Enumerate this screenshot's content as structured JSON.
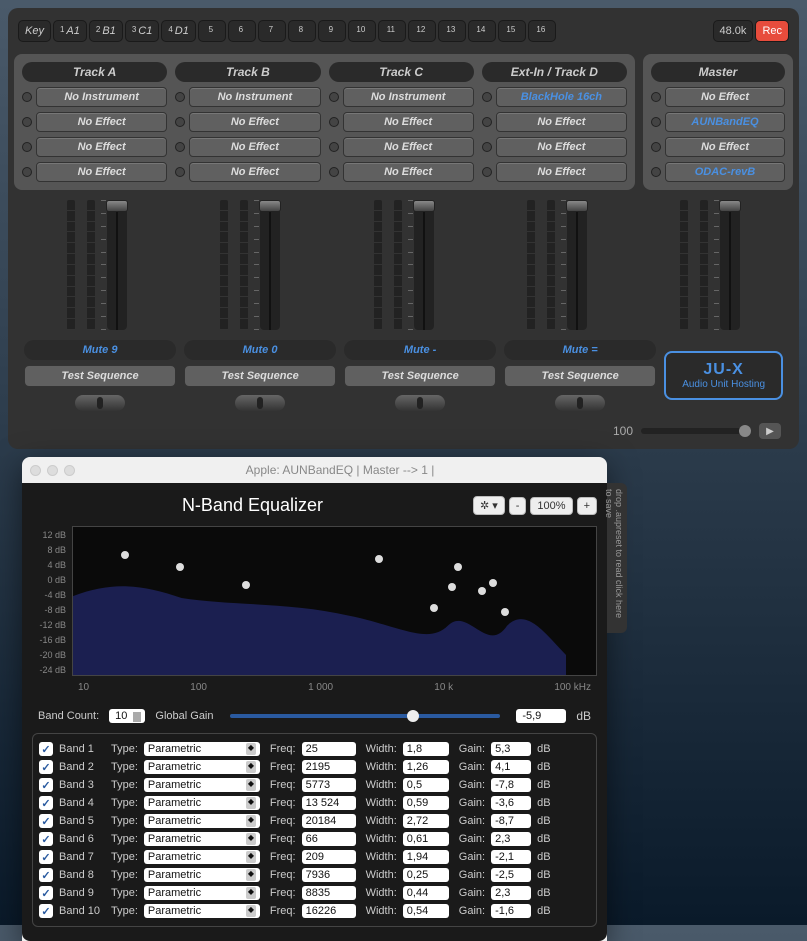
{
  "keyrow": {
    "key": "Key",
    "slots": [
      "A1",
      "B1",
      "C1",
      "D1",
      "",
      "",
      "",
      "",
      "",
      "",
      "",
      "",
      "",
      "",
      "",
      ""
    ],
    "sample_rate": "48.0k",
    "rec": "Rec"
  },
  "tracks": [
    {
      "name": "Track A",
      "instrument": "No Instrument",
      "fx": [
        "No Effect",
        "No Effect",
        "No Effect"
      ],
      "mute": "Mute  9",
      "test": "Test Sequence"
    },
    {
      "name": "Track B",
      "instrument": "No Instrument",
      "fx": [
        "No Effect",
        "No Effect",
        "No Effect"
      ],
      "mute": "Mute  0",
      "test": "Test Sequence"
    },
    {
      "name": "Track C",
      "instrument": "No Instrument",
      "fx": [
        "No Effect",
        "No Effect",
        "No Effect"
      ],
      "mute": "Mute  -",
      "test": "Test Sequence"
    },
    {
      "name": "Ext-In / Track D",
      "instrument": "BlackHole 16ch",
      "inst_blue": true,
      "fx": [
        "No Effect",
        "No Effect",
        "No Effect"
      ],
      "mute": "Mute  =",
      "test": "Test Sequence"
    }
  ],
  "master": {
    "name": "Master",
    "slots": [
      "No Effect",
      "AUNBandEQ",
      "No Effect",
      "ODAC-revB"
    ],
    "blue": [
      false,
      true,
      false,
      true
    ]
  },
  "logo": {
    "title": "JU‑X",
    "sub": "Audio Unit Hosting"
  },
  "playback": {
    "value": "100"
  },
  "plugin": {
    "titlebar": "Apple: AUNBandEQ  | Master --> 1 |",
    "title": "N-Band Equalizer",
    "zoom": "100%",
    "sidetab": "drop .aupreset to read\nclick here to save",
    "axis_y": [
      "12 dB",
      "8 dB",
      "4 dB",
      "0 dB",
      "-4 dB",
      "-8 dB",
      "-12 dB",
      "-16 dB",
      "-20 dB",
      "-24 dB"
    ],
    "axis_x": [
      "10",
      "100",
      "1 000",
      "10 k",
      "100 kHz"
    ],
    "band_count_label": "Band Count:",
    "band_count": "10",
    "global_gain_label": "Global Gain",
    "global_gain": "-5,9",
    "db": "dB",
    "col_type": "Type:",
    "col_freq": "Freq:",
    "col_width": "Width:",
    "col_gain": "Gain:",
    "type_value": "Parametric",
    "bands": [
      {
        "name": "Band 1",
        "freq": "25",
        "width": "1,8",
        "gain": "5,3"
      },
      {
        "name": "Band 2",
        "freq": "2195",
        "width": "1,26",
        "gain": "4,1"
      },
      {
        "name": "Band 3",
        "freq": "5773",
        "width": "0,5",
        "gain": "-7,8"
      },
      {
        "name": "Band 4",
        "freq": "13 524",
        "width": "0,59",
        "gain": "-3,6"
      },
      {
        "name": "Band 5",
        "freq": "20184",
        "width": "2,72",
        "gain": "-8,7"
      },
      {
        "name": "Band 6",
        "freq": "66",
        "width": "0,61",
        "gain": "2,3"
      },
      {
        "name": "Band 7",
        "freq": "209",
        "width": "1,94",
        "gain": "-2,1"
      },
      {
        "name": "Band 8",
        "freq": "7936",
        "width": "0,25",
        "gain": "-2,5"
      },
      {
        "name": "Band 9",
        "freq": "8835",
        "width": "0,44",
        "gain": "2,3"
      },
      {
        "name": "Band 10",
        "freq": "16226",
        "width": "0,54",
        "gain": "-1,6"
      }
    ]
  },
  "chart_data": {
    "type": "line",
    "title": "N-Band Equalizer",
    "xscale": "log",
    "xlabel": "Hz",
    "ylabel": "dB",
    "ylim": [
      -24,
      12
    ],
    "xlim": [
      10,
      100000
    ],
    "series": [
      {
        "name": "band-points",
        "points": [
          {
            "x": 25,
            "y": 5.3
          },
          {
            "x": 66,
            "y": 2.3
          },
          {
            "x": 209,
            "y": -2.1
          },
          {
            "x": 2195,
            "y": 4.1
          },
          {
            "x": 5773,
            "y": -7.8
          },
          {
            "x": 7936,
            "y": -2.5
          },
          {
            "x": 8835,
            "y": 2.3
          },
          {
            "x": 13524,
            "y": -3.6
          },
          {
            "x": 16226,
            "y": -1.6
          },
          {
            "x": 20184,
            "y": -8.7
          }
        ]
      }
    ],
    "global_gain_db": -5.9
  }
}
